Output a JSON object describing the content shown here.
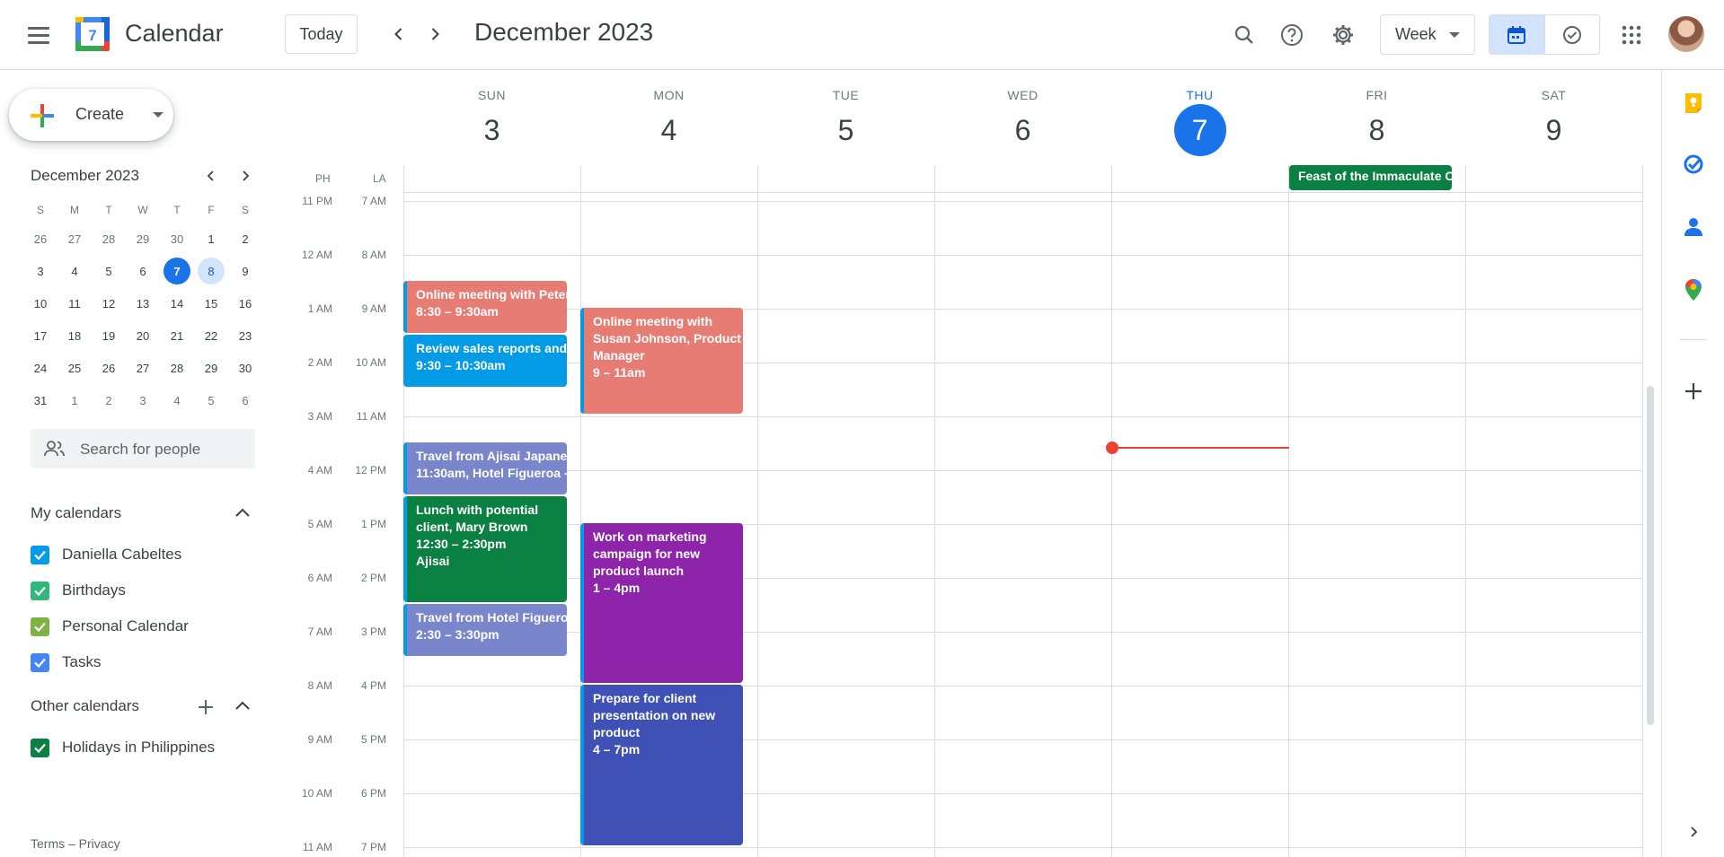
{
  "header": {
    "app_title": "Calendar",
    "logo_day": "7",
    "today_label": "Today",
    "month_title": "December 2023",
    "view_label": "Week"
  },
  "sidebar": {
    "create_label": "Create",
    "mini_cal": {
      "title": "December 2023",
      "dow": [
        "S",
        "M",
        "T",
        "W",
        "T",
        "F",
        "S"
      ],
      "weeks": [
        [
          "26",
          "27",
          "28",
          "29",
          "30",
          "1",
          "2"
        ],
        [
          "3",
          "4",
          "5",
          "6",
          "7",
          "8",
          "9"
        ],
        [
          "10",
          "11",
          "12",
          "13",
          "14",
          "15",
          "16"
        ],
        [
          "17",
          "18",
          "19",
          "20",
          "21",
          "22",
          "23"
        ],
        [
          "24",
          "25",
          "26",
          "27",
          "28",
          "29",
          "30"
        ],
        [
          "31",
          "1",
          "2",
          "3",
          "4",
          "5",
          "6"
        ]
      ],
      "today": "7",
      "selected": "8"
    },
    "search_people_placeholder": "Search for people",
    "my_calendars_title": "My calendars",
    "my_calendars": [
      {
        "label": "Daniella Cabeltes",
        "color": "#039be5"
      },
      {
        "label": "Birthdays",
        "color": "#33b679"
      },
      {
        "label": "Personal Calendar",
        "color": "#7cb342"
      },
      {
        "label": "Tasks",
        "color": "#4285f4"
      }
    ],
    "other_calendars_title": "Other calendars",
    "other_calendars": [
      {
        "label": "Holidays in Philippines",
        "color": "#0b8043"
      }
    ],
    "footer": "Terms – Privacy"
  },
  "week": {
    "days": [
      {
        "dow": "SUN",
        "num": "3"
      },
      {
        "dow": "MON",
        "num": "4"
      },
      {
        "dow": "TUE",
        "num": "5"
      },
      {
        "dow": "WED",
        "num": "6"
      },
      {
        "dow": "THU",
        "num": "7"
      },
      {
        "dow": "FRI",
        "num": "8"
      },
      {
        "dow": "SAT",
        "num": "9"
      }
    ],
    "today_index": 4,
    "tz_labels": [
      "PH",
      "LA"
    ],
    "all_day_event": "Feast of the Immaculate Conception",
    "times": [
      {
        "ph": "11 PM",
        "la": "7 AM"
      },
      {
        "ph": "12 AM",
        "la": "8 AM"
      },
      {
        "ph": "1 AM",
        "la": "9 AM"
      },
      {
        "ph": "2 AM",
        "la": "10 AM"
      },
      {
        "ph": "3 AM",
        "la": "11 AM"
      },
      {
        "ph": "4 AM",
        "la": "12 PM"
      },
      {
        "ph": "5 AM",
        "la": "1 PM"
      },
      {
        "ph": "6 AM",
        "la": "2 PM"
      },
      {
        "ph": "7 AM",
        "la": "3 PM"
      },
      {
        "ph": "8 AM",
        "la": "4 PM"
      },
      {
        "ph": "9 AM",
        "la": "5 PM"
      },
      {
        "ph": "10 AM",
        "la": "6 PM"
      },
      {
        "ph": "11 AM",
        "la": "7 PM"
      }
    ]
  },
  "events": {
    "e1": {
      "title": "Online meeting with Peter",
      "time": "8:30 – 9:30am",
      "color": "#e67c73"
    },
    "e2": {
      "title": "Review sales reports and",
      "time": "9:30 – 10:30am",
      "color": "#039be5"
    },
    "e3": {
      "title": "Travel from Ajisai Japanese",
      "time": "11:30am, Hotel Figueroa -",
      "color": "#7986cb"
    },
    "e4": {
      "title": "Lunch with potential client, Mary Brown",
      "time": "12:30 – 2:30pm",
      "location": "Ajisai",
      "color": "#0b8043"
    },
    "e5": {
      "title": "Travel from Hotel Figueroa",
      "time": "2:30 – 3:30pm",
      "color": "#7986cb"
    },
    "e6": {
      "title": "Online meeting with Susan Johnson, Product Manager",
      "time": "9 – 11am",
      "color": "#e67c73"
    },
    "e7": {
      "title": "Work on marketing campaign for new product launch",
      "time": "1 – 4pm",
      "color": "#8e24aa"
    },
    "e8": {
      "title": "Prepare for client presentation on new product",
      "time": "4 – 7pm",
      "color": "#3f51b5"
    }
  }
}
